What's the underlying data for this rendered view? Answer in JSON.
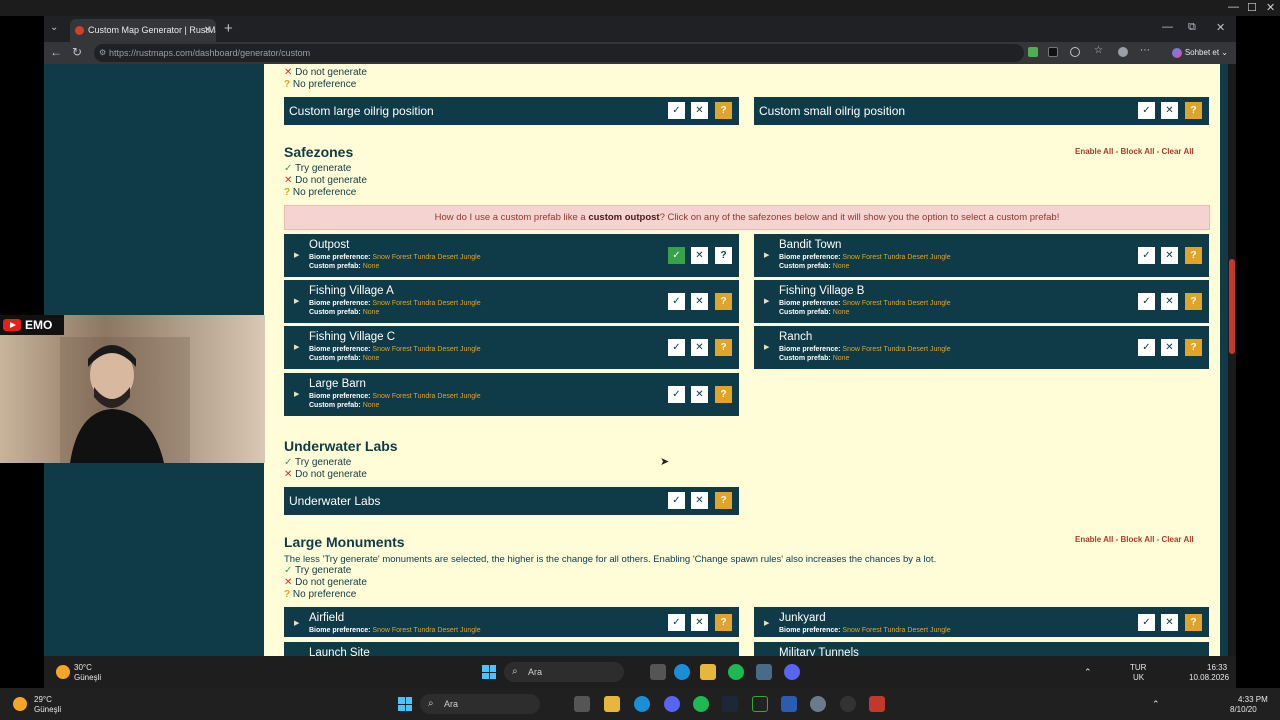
{
  "browser": {
    "tab_title": "Custom Map Generator | RustMaps",
    "url": "https://rustmaps.com/dashboard/generator/custom",
    "profile_label": "Sohbet et"
  },
  "legend": {
    "try": "Try generate",
    "dont": "Do not generate",
    "none": "No preference"
  },
  "oilrigs": [
    {
      "name": "Custom large oilrig position"
    },
    {
      "name": "Custom small oilrig position"
    }
  ],
  "safezones": {
    "title": "Safezones",
    "bulk": "Enable All - Block All - Clear All",
    "hint_pre": "How do I use a custom prefab like a ",
    "hint_bold": "custom outpost",
    "hint_post": "? Click on any of the safezones below and it will show you the option to select a custom prefab!",
    "biome_label": "Biome preference:",
    "biome_value": "Snow Forest Tundra Desert Jungle",
    "prefab_label": "Custom prefab:",
    "prefab_value": "None",
    "items": [
      {
        "name": "Outpost"
      },
      {
        "name": "Bandit Town"
      },
      {
        "name": "Fishing Village A"
      },
      {
        "name": "Fishing Village B"
      },
      {
        "name": "Fishing Village C"
      },
      {
        "name": "Ranch"
      },
      {
        "name": "Large Barn"
      }
    ]
  },
  "underwater": {
    "title": "Underwater Labs",
    "item": "Underwater Labs"
  },
  "monuments": {
    "title": "Large Monuments",
    "bulk": "Enable All - Block All - Clear All",
    "desc": "The less 'Try generate' monuments are selected, the higher is the change for all others. Enabling 'Change spawn rules' also increases the chances by a lot.",
    "items": [
      {
        "name": "Airfield"
      },
      {
        "name": "Junkyard"
      },
      {
        "name": "Launch Site"
      },
      {
        "name": "Military Tunnels"
      }
    ]
  },
  "webcam": {
    "label": "EMO"
  },
  "taskbar_inner": {
    "temp": "30°C",
    "weather": "Güneşli",
    "search": "Ara",
    "lang1": "TUR",
    "lang2": "UK",
    "time": "16:33",
    "date": "10.08.2026"
  },
  "taskbar_outer": {
    "temp": "29°C",
    "weather": "Güneşli",
    "search": "Ara",
    "time": "4:33 PM",
    "date": "8/10/20"
  },
  "colors": {
    "dark_teal": "#0f3a47",
    "cream": "#fffdd8",
    "accent_orange": "#e0a42a",
    "accent_red": "#c9362a",
    "accent_green": "#3aa14b"
  }
}
